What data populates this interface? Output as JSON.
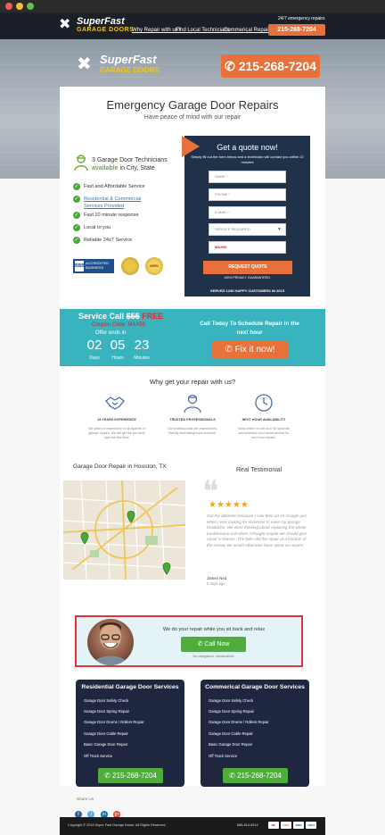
{
  "nav": {
    "logo_line1": "SuperFast",
    "logo_line2": "GARAGE DOORS",
    "links": [
      "Why Repair with us?",
      "Find Local Technicians",
      "Commerical Repairs"
    ],
    "emergency_label": "24/7 emergency repairs",
    "phone": "215-268-7204"
  },
  "hero": {
    "logo_line1": "SuperFast",
    "logo_line2": "GARAGE DOORS",
    "phone": "215-268-7204"
  },
  "main": {
    "title": "Emergency Garage Door Repairs",
    "subtitle": "Have peace of mind with our repair",
    "tech_line1": "3 Garage Door Technicians",
    "tech_available": "available",
    "tech_location": " in City, State",
    "features": [
      {
        "text": "Fast and Affordable Service",
        "link": false
      },
      {
        "text": "Residential & Commercial Services Provided",
        "link": true
      },
      {
        "text": "Fast 10 minute response",
        "link": false
      },
      {
        "text": "Local to you",
        "link": false
      },
      {
        "text": "Reliable 24x7 Service",
        "link": false
      }
    ],
    "bbb_text": "ACCREDITED BUSINESS",
    "badge_text": "100%"
  },
  "quote": {
    "title": "Get a quote now!",
    "desc": "Simply fill out the form below and a technician will contact you within 10 minutes",
    "fields": [
      "NAME *",
      "PHONE *",
      "E-MAIL *",
      "SERVICE REQUIRED",
      "MAX50"
    ],
    "button": "REQUEST QUOTE",
    "privacy": "100% PRIVACY GUARANTEED.",
    "served": "SERVED 1230 HAPPY CUSTOMERS IN 2015"
  },
  "promo": {
    "service_call": "Service Call",
    "old_price": "$55",
    "free": "FREE",
    "coupon": "Coupon Code: MAX50",
    "offer_ends": "Offer ends in",
    "days": "02",
    "hours": "05",
    "minutes": "23",
    "days_label": "Days",
    "hours_label": "Hours",
    "minutes_label": "Minutes",
    "call_today": "Call Today To Schedule Repair in the next hour",
    "fix_button": "Fix it now!"
  },
  "why": {
    "title": "Why get your repair with us?",
    "items": [
      {
        "head": "15 YEARS EXPERIENCE",
        "text": "We years of experience in all aspects of garage repairs. We will get the job done right the first time!"
      },
      {
        "head": "TRUSTED PROFESSIONALS",
        "text": "Our professionals are experienced, friendly and background-checked."
      },
      {
        "head": "NEXT HOUR AVAILABILITY",
        "text": "Book online or call us in 60 seconds and schedule your home service for next hour repairs."
      }
    ]
  },
  "map": {
    "title": "Garage Door Repair in Houston, TX"
  },
  "testimonial": {
    "title": "Real Testimonial",
    "stars": "★★★★★",
    "text": "Got my attention because I saw their ad on Google just when I was looking for someone to ease my garage headache. We were thinking about replacing the whole troublesome unit when I thought maybe we should give repair a chance. The folks did the repair at a fraction of the money we would otherwise have spent on repairs.",
    "name": "James Ned",
    "ago": "5 days ago"
  },
  "cta": {
    "line": "We do your repair while you sit back and relax",
    "button": "Call Now",
    "note": "No obligation, whatsoever."
  },
  "services": [
    {
      "title": "Residential Garage Door Services",
      "items": [
        "Garage Door Safety Check",
        "Garage Door Spring Repair",
        "Garage Door Drums / Rollers Repair",
        "Garage Door Cable Repair",
        "Basic Garage Door Repair",
        "Off Track Service"
      ],
      "phone": "215-268-7204"
    },
    {
      "title": "Commerical Garage Door Services",
      "items": [
        "Garage Door Safety Check",
        "Garage Door Spring Repair",
        "Garage Door Drums / Rollers Repair",
        "Garage Door Cable Repair",
        "Basic Garage Door Repair",
        "Off Track Service"
      ],
      "phone": "215-268-7204"
    }
  ],
  "share": {
    "label": "Share Us",
    "icons": [
      "f",
      "t",
      "in",
      "g+"
    ]
  },
  "footer": {
    "copyright": "Copyright © 2015 Super Fast Garage Doors. All Rights Reserved.",
    "phone": "888-814-8914",
    "payments": [
      "MC",
      "DISC",
      "VISA",
      "AMEX"
    ]
  },
  "colors": {
    "accent": "#e8703a",
    "teal": "#39b3bd",
    "navy": "#1f3249",
    "green": "#4fae3b"
  }
}
